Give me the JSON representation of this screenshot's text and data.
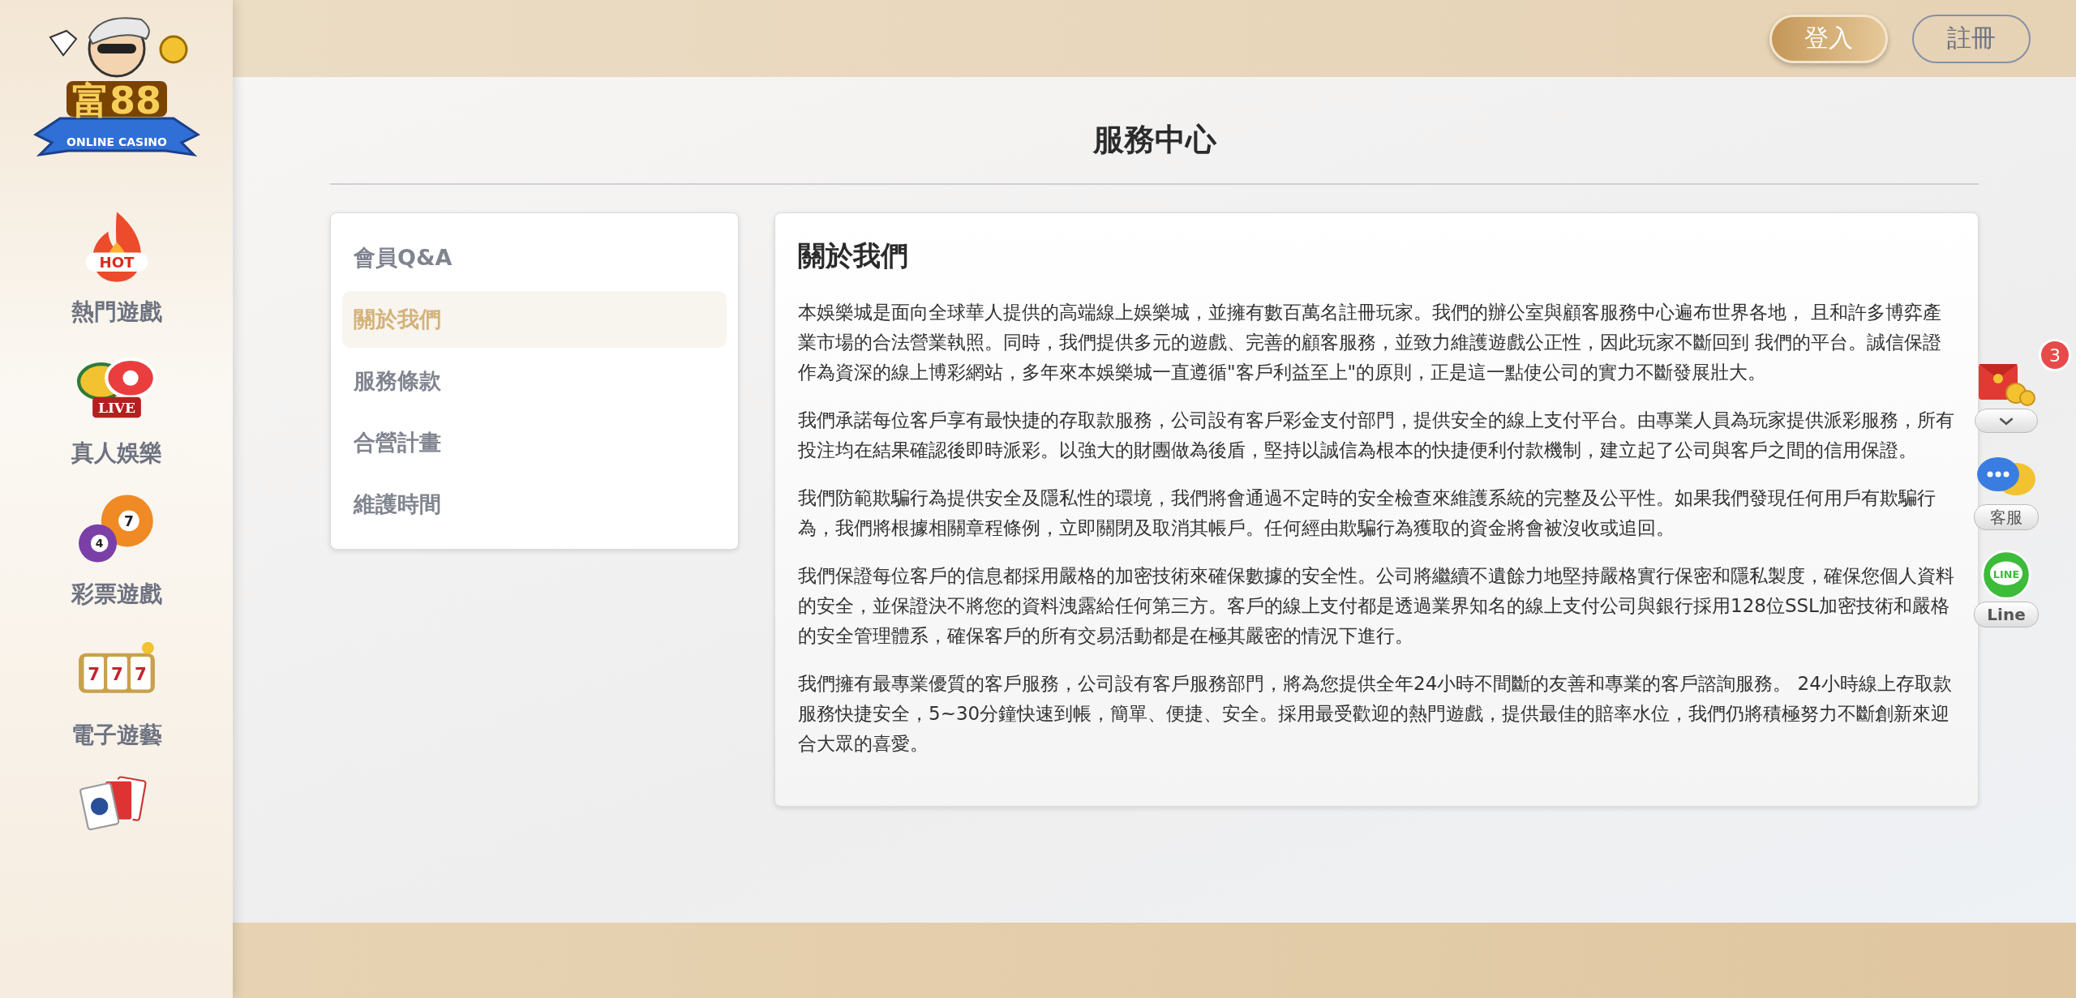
{
  "logo": {
    "name": "富88",
    "tagline": "ONLINE CASINO"
  },
  "sidebar": {
    "items": [
      {
        "kind": "hot",
        "label": "熱門遊戲",
        "icon_texts": [
          "HOT"
        ]
      },
      {
        "kind": "live",
        "label": "真人娛樂",
        "icon_texts": [
          "LIVE"
        ]
      },
      {
        "kind": "lottery",
        "label": "彩票遊戲",
        "icon_texts": [
          "4",
          "7"
        ]
      },
      {
        "kind": "slots",
        "label": "電子遊藝",
        "icon_texts": [
          "7",
          "7",
          "7"
        ]
      },
      {
        "kind": "cards"
      }
    ]
  },
  "header": {
    "buttons": [
      {
        "kind": "primary",
        "label": "登入"
      },
      {
        "kind": "outline",
        "label": "註冊"
      }
    ]
  },
  "page_title": "服務中心",
  "menu": {
    "items": [
      {
        "label": "會員Q&A",
        "selected": false
      },
      {
        "label": "關於我們",
        "selected": true
      },
      {
        "label": "服務條款",
        "selected": false
      },
      {
        "label": "合營計畫",
        "selected": false
      },
      {
        "label": "維護時間",
        "selected": false
      }
    ]
  },
  "article": {
    "title": "關於我們",
    "paragraphs": [
      "本娛樂城是面向全球華人提供的高端線上娛樂城，並擁有數百萬名註冊玩家。我們的辦公室與顧客服務中心遍布世界各地， 且和許多博弈產業市場的合法營業執照。同時，我們提供多元的遊戲、完善的顧客服務，並致力維護遊戲公正性，因此玩家不斷回到 我們的平台。誠信保證作為資深的線上博彩網站，多年來本娛樂城一直遵循\"客戶利益至上\"的原則，正是這一點使公司的實力不斷發展壯大。",
      "我們承諾每位客戶享有最快捷的存取款服務，公司設有客戶彩金支付部門，提供安全的線上支付平台。由專業人員為玩家提供派彩服務，所有投注均在結果確認後即時派彩。以強大的財團做為後盾，堅持以誠信為根本的快捷便利付款機制，建立起了公司與客戶之間的信用保證。",
      "我們防範欺騙行為提供安全及隱私性的環境，我們將會通過不定時的安全檢查來維護系統的完整及公平性。如果我們發現任何用戶有欺騙行為，我們將根據相關章程條例，立即關閉及取消其帳戶。任何經由欺騙行為獲取的資金將會被沒收或追回。",
      "我們保證每位客戶的信息都採用嚴格的加密技術來確保數據的安全性。公司將繼續不遺餘力地堅持嚴格實行保密和隱私製度，確保您個人資料的安全，並保證決不將您的資料洩露給任何第三方。客戶的線上支付都是透過業界知名的線上支付公司與銀行採用128位SSL加密技術和嚴格的安全管理體系，確保客戶的所有交易活動都是在極其嚴密的情況下進行。",
      "我們擁有最專業優質的客戶服務，公司設有客戶服務部門，將為您提供全年24小時不間斷的友善和專業的客戶諮詢服務。 24小時線上存取款服務快捷安全，5~30分鐘快速到帳，簡單、便捷、安全。採用最受歡迎的熱門遊戲，提供最佳的賠率水位，我們仍將積極努力不斷創新來迎合大眾的喜愛。"
    ]
  },
  "floating": [
    {
      "kind": "redpacket",
      "badge": "3"
    },
    {
      "kind": "chat",
      "label": "客服"
    },
    {
      "kind": "line",
      "icon_text": "LINE",
      "label": "Line"
    }
  ]
}
